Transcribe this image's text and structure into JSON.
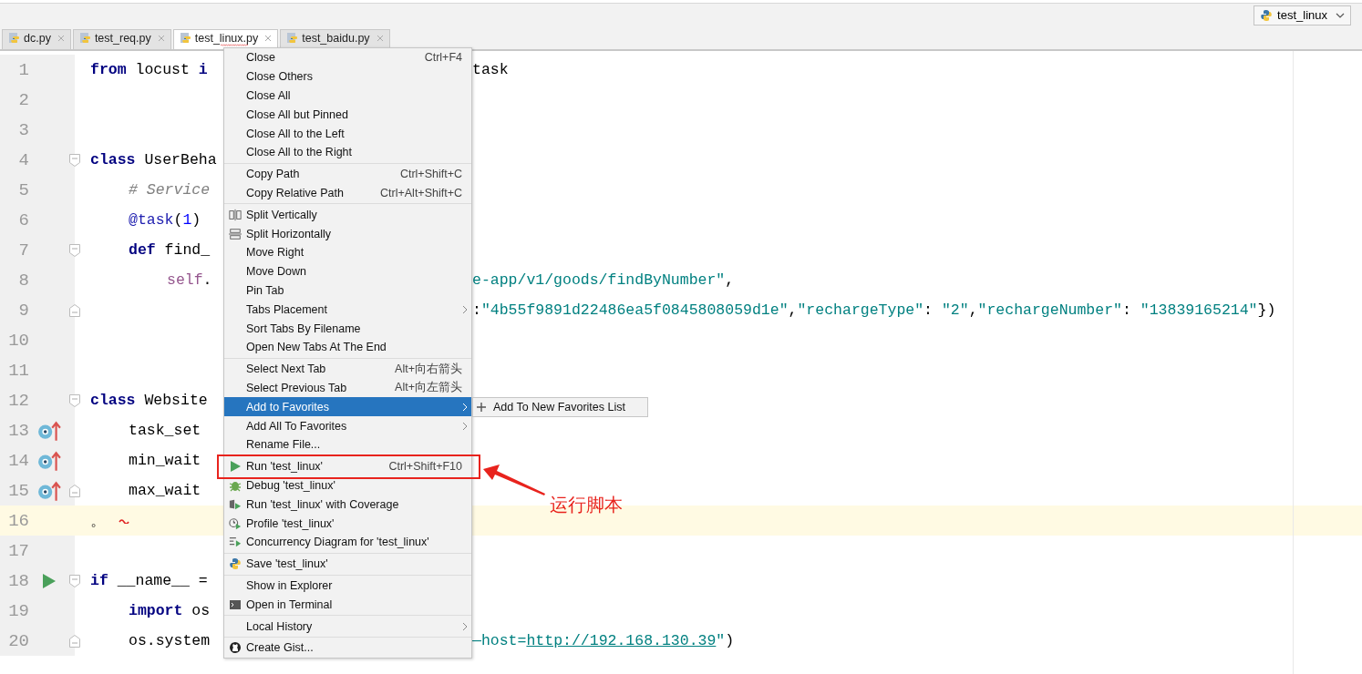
{
  "run_config": {
    "label": "test_linux"
  },
  "tabs": [
    {
      "label": "dc.py",
      "selected": false,
      "error": false
    },
    {
      "label": "test_req.py",
      "selected": false,
      "error": false
    },
    {
      "label": "test_linux.py",
      "selected": true,
      "error": true
    },
    {
      "label": "test_baidu.py",
      "selected": false,
      "error": false
    }
  ],
  "lines": [
    {
      "number": "1",
      "kind": "plain",
      "current": false,
      "error": false,
      "left": [
        {
          "text": "from",
          "kind": "keyword"
        },
        {
          "text": " locust ",
          "kind": "plain"
        },
        {
          "text": "i",
          "kind": "keyword"
        }
      ],
      "right": [
        {
          "text": "task",
          "kind": "plain"
        }
      ]
    },
    {
      "number": "2",
      "kind": "plain",
      "current": false,
      "error": false
    },
    {
      "number": "3",
      "kind": "plain",
      "current": false,
      "error": false
    },
    {
      "number": "4",
      "kind": "plain",
      "current": false,
      "error": false,
      "left": [
        {
          "text": "class",
          "kind": "keyword"
        },
        {
          "text": " UserBeha",
          "kind": "plain"
        }
      ],
      "children": [
        {
          "number": "5",
          "kind": "plain",
          "current": false,
          "error": false,
          "left": [
            {
              "text": "# Service",
              "kind": "comment"
            }
          ]
        },
        {
          "number": "6",
          "kind": "plain",
          "current": false,
          "error": false,
          "left": [
            {
              "text": "@task",
              "kind": "decorator"
            },
            {
              "text": "(",
              "kind": "plain"
            },
            {
              "text": "1",
              "kind": "number"
            },
            {
              "text": ")",
              "kind": "plain"
            }
          ]
        },
        {
          "number": "7",
          "kind": "plain",
          "current": false,
          "error": false,
          "left": [
            {
              "text": "def",
              "kind": "keyword"
            },
            {
              "text": " find_",
              "kind": "plain"
            }
          ],
          "children": [
            {
              "number": "8",
              "kind": "plain",
              "current": false,
              "error": false,
              "left": [
                {
                  "text": "self",
                  "kind": "self"
                },
                {
                  "text": ".",
                  "kind": "plain"
                }
              ],
              "right": [
                {
                  "text": "e-app/v1/goods/findByNumber\"",
                  "kind": "string"
                },
                {
                  "text": ",",
                  "kind": "plain"
                }
              ]
            },
            {
              "number": "9",
              "kind": "plain",
              "current": false,
              "error": false,
              "right": [
                {
                  "text": ":",
                  "kind": "plain"
                },
                {
                  "text": "\"4b55f9891d22486ea5f0845808059d1e\"",
                  "kind": "string"
                },
                {
                  "text": ",",
                  "kind": "plain"
                },
                {
                  "text": "\"rechargeType\"",
                  "kind": "string"
                },
                {
                  "text": ": ",
                  "kind": "plain"
                },
                {
                  "text": "\"2\"",
                  "kind": "string"
                },
                {
                  "text": ",",
                  "kind": "plain"
                },
                {
                  "text": "\"rechargeNumber\"",
                  "kind": "string"
                },
                {
                  "text": ": ",
                  "kind": "plain"
                },
                {
                  "text": "\"13839165214\"",
                  "kind": "string"
                },
                {
                  "text": "})",
                  "kind": "plain"
                }
              ]
            }
          ]
        }
      ]
    },
    {
      "number": "10",
      "kind": "plain",
      "current": false,
      "error": false
    },
    {
      "number": "11",
      "kind": "plain",
      "current": false,
      "error": false
    },
    {
      "number": "12",
      "kind": "plain",
      "current": false,
      "error": false,
      "left": [
        {
          "text": "class",
          "kind": "keyword"
        },
        {
          "text": " Website",
          "kind": "plain"
        }
      ],
      "children": [
        {
          "number": "13",
          "kind": "override",
          "current": false,
          "error": false,
          "left": [
            {
              "text": "task_set",
              "kind": "plain"
            }
          ]
        },
        {
          "number": "14",
          "kind": "override",
          "current": false,
          "error": false,
          "left": [
            {
              "text": "min_wait",
              "kind": "plain"
            }
          ]
        },
        {
          "number": "15",
          "kind": "override",
          "current": false,
          "error": false,
          "left": [
            {
              "text": "max_wait",
              "kind": "plain"
            }
          ]
        }
      ]
    },
    {
      "number": "16",
      "kind": "plain",
      "current": true,
      "error": true,
      "left": [
        {
          "text": "。",
          "kind": "plain"
        }
      ]
    },
    {
      "number": "17",
      "kind": "plain",
      "current": false,
      "error": false
    },
    {
      "number": "18",
      "kind": "run",
      "current": false,
      "error": false,
      "left": [
        {
          "text": "if",
          "kind": "keyword"
        },
        {
          "text": " __name__ =",
          "kind": "plain"
        }
      ],
      "children": [
        {
          "number": "19",
          "kind": "plain",
          "current": false,
          "error": false,
          "left": [
            {
              "text": "import",
              "kind": "keyword"
            },
            {
              "text": " os",
              "kind": "plain"
            }
          ]
        },
        {
          "number": "20",
          "kind": "plain",
          "current": false,
          "error": false,
          "left": [
            {
              "text": "os.system",
              "kind": "plain"
            }
          ],
          "right": [
            {
              "text": "—host=",
              "kind": "string"
            },
            {
              "text": "http://192.168.130.39",
              "kind": "link"
            },
            {
              "text": "\"",
              "kind": "string"
            },
            {
              "text": ")",
              "kind": "plain"
            }
          ]
        }
      ]
    }
  ],
  "menu": [
    [
      {
        "label": "Close",
        "kind": "plain",
        "shortcut": "Ctrl+F4",
        "submenu": false,
        "selected": false,
        "framed": false
      },
      {
        "label": "Close Others",
        "kind": "plain",
        "submenu": false,
        "selected": false,
        "framed": false
      },
      {
        "label": "Close All",
        "kind": "plain",
        "submenu": false,
        "selected": false,
        "framed": false
      },
      {
        "label": "Close All but Pinned",
        "kind": "plain",
        "submenu": false,
        "selected": false,
        "framed": false
      },
      {
        "label": "Close All to the Left",
        "kind": "plain",
        "submenu": false,
        "selected": false,
        "framed": false
      },
      {
        "label": "Close All to the Right",
        "kind": "plain",
        "submenu": false,
        "selected": false,
        "framed": false
      }
    ],
    [
      {
        "label": "Copy Path",
        "kind": "plain",
        "shortcut": "Ctrl+Shift+C",
        "submenu": false,
        "selected": false,
        "framed": false
      },
      {
        "label": "Copy Relative Path",
        "kind": "plain",
        "shortcut": "Ctrl+Alt+Shift+C",
        "submenu": false,
        "selected": false,
        "framed": false
      }
    ],
    [
      {
        "label": "Split Vertically",
        "kind": "split-vertical",
        "submenu": false,
        "selected": false,
        "framed": false
      },
      {
        "label": "Split Horizontally",
        "kind": "split-horizontal",
        "submenu": false,
        "selected": false,
        "framed": false
      },
      {
        "label": "Move Right",
        "kind": "plain",
        "submenu": false,
        "selected": false,
        "framed": false
      },
      {
        "label": "Move Down",
        "kind": "plain",
        "submenu": false,
        "selected": false,
        "framed": false
      },
      {
        "label": "Pin Tab",
        "kind": "plain",
        "submenu": false,
        "selected": false,
        "framed": false
      },
      {
        "label": "Tabs Placement",
        "kind": "plain",
        "submenu": true,
        "selected": false,
        "framed": false
      },
      {
        "label": "Sort Tabs By Filename",
        "kind": "plain",
        "submenu": false,
        "selected": false,
        "framed": false
      },
      {
        "label": "Open New Tabs At The End",
        "kind": "plain",
        "submenu": false,
        "selected": false,
        "framed": false
      }
    ],
    [
      {
        "label": "Select Next Tab",
        "kind": "plain",
        "shortcut": "Alt+向右箭头",
        "submenu": false,
        "selected": false,
        "framed": false
      },
      {
        "label": "Select Previous Tab",
        "kind": "plain",
        "shortcut": "Alt+向左箭头",
        "submenu": false,
        "selected": false,
        "framed": false
      },
      {
        "label": "Add to Favorites",
        "kind": "plain",
        "submenu": true,
        "selected": true,
        "framed": false
      },
      {
        "label": "Add All To Favorites",
        "kind": "plain",
        "submenu": true,
        "selected": false,
        "framed": false
      },
      {
        "label": "Rename File...",
        "kind": "plain",
        "submenu": false,
        "selected": false,
        "framed": false
      }
    ],
    [
      {
        "label": "Run 'test_linux'",
        "kind": "run",
        "shortcut": "Ctrl+Shift+F10",
        "submenu": false,
        "selected": false,
        "framed": true
      },
      {
        "label": "Debug 'test_linux'",
        "kind": "debug",
        "submenu": false,
        "selected": false,
        "framed": false
      },
      {
        "label": "Run 'test_linux' with Coverage",
        "kind": "coverage",
        "submenu": false,
        "selected": false,
        "framed": false
      },
      {
        "label": "Profile 'test_linux'",
        "kind": "profile",
        "submenu": false,
        "selected": false,
        "framed": false
      },
      {
        "label": "Concurrency Diagram for 'test_linux'",
        "kind": "concurrency",
        "submenu": false,
        "selected": false,
        "framed": false
      }
    ],
    [
      {
        "label": "Save 'test_linux'",
        "kind": "python",
        "submenu": false,
        "selected": false,
        "framed": false
      }
    ],
    [
      {
        "label": "Show in Explorer",
        "kind": "plain",
        "submenu": false,
        "selected": false,
        "framed": false
      },
      {
        "label": "Open in Terminal",
        "kind": "terminal",
        "submenu": false,
        "selected": false,
        "framed": false
      }
    ],
    [
      {
        "label": "Local History",
        "kind": "plain",
        "submenu": true,
        "selected": false,
        "framed": false
      }
    ],
    [
      {
        "label": "Create Gist...",
        "kind": "gist",
        "submenu": false,
        "selected": false,
        "framed": false
      }
    ]
  ],
  "submenu": {
    "items": [
      {
        "label": "Add To New Favorites List"
      }
    ]
  },
  "annotation": {
    "label": "运行脚本"
  }
}
